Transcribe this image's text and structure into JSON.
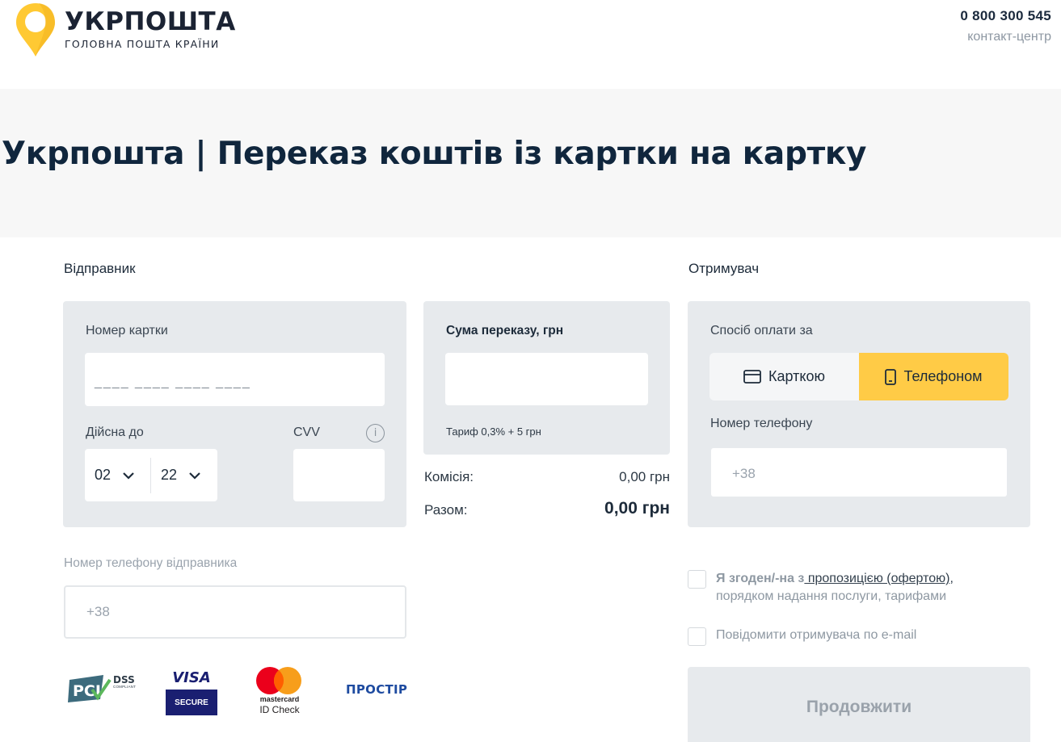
{
  "header": {
    "brand_name": "УКРПОШТА",
    "brand_tagline": "ГОЛОВНА ПОШТА КРАЇНИ",
    "phone": "0 800 300 545",
    "phone_label": "контакт-центр"
  },
  "page_title": "Укрпошта | Переказ коштів із картки на картку",
  "sender": {
    "section_title": "Відправник",
    "card_number_label": "Номер картки",
    "card_number_placeholder": "____ ____ ____ ____",
    "expiry_label": "Дійсна до",
    "expiry_month": "02",
    "expiry_year": "22",
    "cvv_label": "CVV",
    "cvv_info": "i",
    "phone_label": "Номер телефону відправника",
    "phone_placeholder": "+38"
  },
  "amount": {
    "label": "Сума переказу, грн",
    "tariff": "Тариф 0,3% + 5 грн",
    "commission_label": "Комісія:",
    "commission_value": "0,00 грн",
    "total_label": "Разом:",
    "total_value": "0,00 грн"
  },
  "receiver": {
    "section_title": "Отримувач",
    "payment_method_label": "Спосіб оплати за",
    "option_card": "Карткою",
    "option_phone": "Телефоном",
    "selected_option": "Телефоном",
    "phone_label": "Номер телефону",
    "phone_placeholder": "+38"
  },
  "agreement": {
    "prefix": "Я згоден/-на з",
    "link": " пропозицією (офертою)",
    "suffix": ",",
    "line2": "порядком надання послуги, тарифами",
    "checked": false
  },
  "notify": {
    "label": "Повідомити отримувача по e-mail",
    "checked": false
  },
  "continue_button": "Продовжити",
  "payment_logos": {
    "pci": "PCI",
    "dss": "DSS",
    "dss_sub": "COMPLIANT",
    "visa": "VISA",
    "visa_secure": "SECURE",
    "mastercard": "mastercard",
    "mastercard_id": "ID Check",
    "prostir": "ПРОСТІР"
  },
  "colors": {
    "accent_yellow": "#ffcb46",
    "panel_bg": "#e7eaed",
    "title_navy": "#10263d"
  }
}
